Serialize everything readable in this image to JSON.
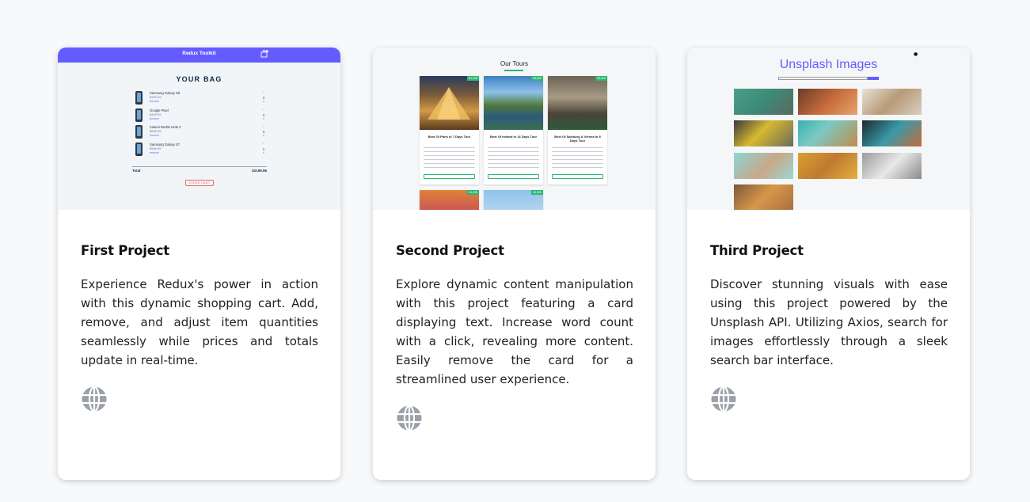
{
  "projects": [
    {
      "title": "First Project",
      "description": "Experience Redux's power in action with this dynamic shopping cart. Add, remove, and adjust item quantities seamlessly while prices and totals update in real-time.",
      "preview": {
        "nav_title": "Redux Toolkit",
        "bag_title": "YOUR BAG",
        "items": [
          {
            "name": "Samsung Galaxy S8",
            "price": "$399.99",
            "remove": "remove",
            "amount": "1"
          },
          {
            "name": "Google Pixel",
            "price": "$499.99",
            "remove": "remove",
            "amount": "1"
          },
          {
            "name": "Xiaomi Redmi Note 2",
            "price": "$699.99",
            "remove": "remove",
            "amount": "1"
          },
          {
            "name": "Samsung Galaxy S7",
            "price": "$599.99",
            "remove": "remove",
            "amount": "1"
          }
        ],
        "total_label": "Total",
        "total_value": "$2199.96",
        "clear_label": "CLEAR CART"
      }
    },
    {
      "title": "Second Project",
      "description": "Explore dynamic content manipulation with this project featuring a card displaying text. Increase word count with a click, revealing more content. Easily remove the card for a streamlined user experience.",
      "preview": {
        "heading": "Our Tours",
        "tours": [
          {
            "name": "Best Of Paris In 7 Days Tour",
            "price": "$1,995"
          },
          {
            "name": "Best Of Ireland In 14 Days Tour",
            "price": "$3,895"
          },
          {
            "name": "Best Of Salzburg & Vienna In 8 Days Tour",
            "price": "$2,695"
          },
          {
            "name": "",
            "price": "$1,295"
          },
          {
            "name": "",
            "price": "$2,595"
          }
        ]
      }
    },
    {
      "title": "Third Project",
      "description": "Discover stunning visuals with ease using this project powered by the Unsplash API. Utilizing Axios, search for images effortlessly through a sleek search bar interface.",
      "preview": {
        "heading": "Unsplash Images"
      }
    }
  ],
  "icons": {
    "globe": "globe-icon",
    "cart": "cart-icon"
  },
  "colors": {
    "accent": "#645cff",
    "green": "#2bb673",
    "icon_gray": "#9aa0a8",
    "page_bg": "#f8f9fb"
  }
}
